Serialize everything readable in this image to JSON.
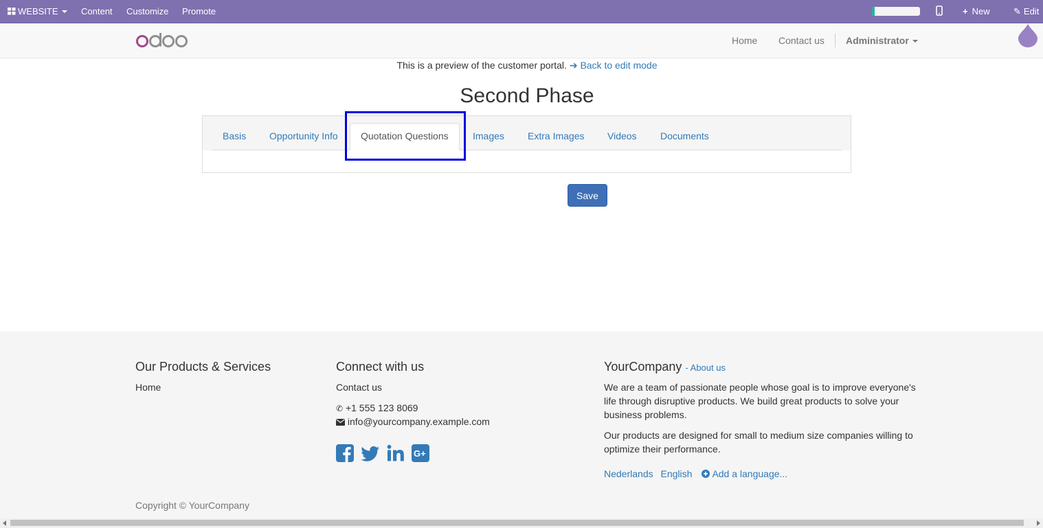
{
  "adminbar": {
    "website_label": "WEBSITE",
    "content_label": "Content",
    "customize_label": "Customize",
    "promote_label": "Promote",
    "progress_fraction": 0.05,
    "new_label": "New",
    "edit_label": "Edit"
  },
  "header": {
    "logo_text": "odoo",
    "nav": {
      "home": "Home",
      "contact": "Contact us",
      "user": "Administrator"
    }
  },
  "main": {
    "preview_text": "This is a preview of the customer portal.",
    "back_link": "Back to edit mode",
    "title": "Second Phase",
    "tabs": [
      {
        "label": "Basis"
      },
      {
        "label": "Opportunity Info"
      },
      {
        "label": "Quotation Questions",
        "active": true
      },
      {
        "label": "Images"
      },
      {
        "label": "Extra Images"
      },
      {
        "label": "Videos"
      },
      {
        "label": "Documents"
      }
    ],
    "save_label": "Save"
  },
  "footer": {
    "col1": {
      "heading": "Our Products & Services",
      "links": [
        "Home"
      ]
    },
    "col2": {
      "heading": "Connect with us",
      "contact_link": "Contact us",
      "phone": "+1 555 123 8069",
      "email": "info@yourcompany.example.com",
      "social_icons": [
        "facebook-icon",
        "twitter-icon",
        "linkedin-icon",
        "google-plus-icon"
      ]
    },
    "col3": {
      "company": "YourCompany",
      "about_link": "About us",
      "para1": "We are a team of passionate people whose goal is to improve everyone's life through disruptive products. We build great products to solve your business problems.",
      "para2": "Our products are designed for small to medium size companies willing to optimize their performance.",
      "languages": [
        "Nederlands",
        "English"
      ],
      "add_language": "Add a language..."
    },
    "copyright": "Copyright © YourCompany"
  },
  "colors": {
    "adminbar": "#7f70b0",
    "link": "#337ab7",
    "highlight": "#0000e0",
    "save": "#3f6fb6"
  }
}
